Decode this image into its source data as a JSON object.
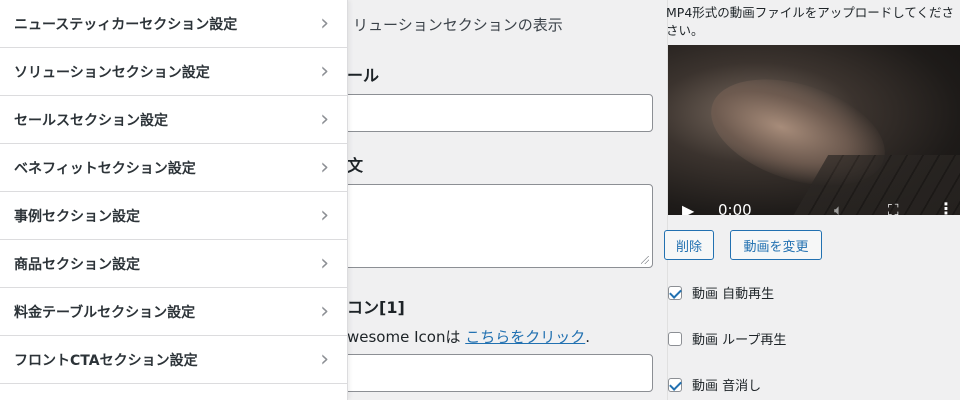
{
  "menu": {
    "items": [
      {
        "label": "ニューステッィカーセクション設定"
      },
      {
        "label": "ソリューションセクション設定"
      },
      {
        "label": "セールスセクション設定"
      },
      {
        "label": "ベネフィットセクション設定"
      },
      {
        "label": "事例セクション設定"
      },
      {
        "label": "商品セクション設定"
      },
      {
        "label": "料金テーブルセクション設定"
      },
      {
        "label": "フロントCTAセクション設定"
      }
    ],
    "chevron_icon": "chevron-right-icon"
  },
  "middle": {
    "heading": "リューションセクションの表示",
    "title_label": "ール",
    "body_label": "文",
    "icon_label": "コン[1]",
    "help_prefix": "wesome Iconは ",
    "help_link": "こちらをクリック",
    "help_suffix": "."
  },
  "right": {
    "note": "MP4形式の動画ファイルをアップロードしてくださ さい。",
    "video": {
      "time": "0:00",
      "progress": 0.14
    },
    "delete_button": "削除",
    "change_button": "動画を変更",
    "checkboxes": [
      {
        "label": "動画 自動再生",
        "checked": true
      },
      {
        "label": "動画 ループ再生",
        "checked": false
      },
      {
        "label": "動画 音消し",
        "checked": true
      }
    ]
  },
  "colors": {
    "accent": "#2271b1",
    "panel_bg": "#f0f0f1",
    "menu_bg": "#ffffff"
  }
}
